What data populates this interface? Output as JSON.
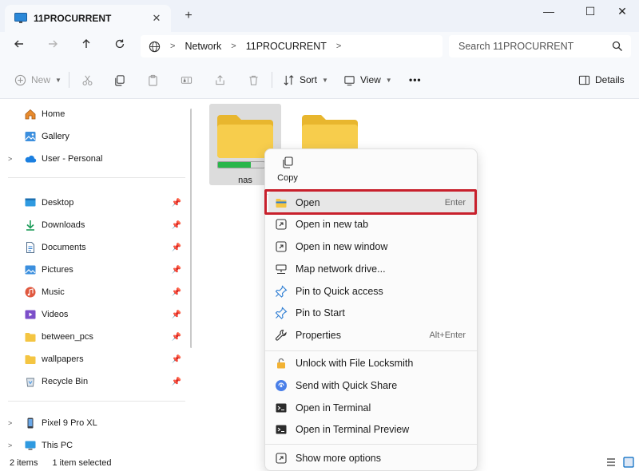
{
  "window": {
    "tab_title": "11PROCURRENT",
    "tab_close": "✕",
    "new_tab": "+",
    "minimize": "—",
    "maximize": "☐",
    "close": "✕"
  },
  "address": {
    "crumbs": [
      "Network",
      "11PROCURRENT"
    ],
    "search_placeholder": "Search 11PROCURRENT"
  },
  "toolbar": {
    "new_label": "New",
    "sort_label": "Sort",
    "view_label": "View",
    "more_label": "•••",
    "details_label": "Details"
  },
  "sidebar": {
    "items": [
      {
        "label": "Home",
        "icon": "home-icon"
      },
      {
        "label": "Gallery",
        "icon": "gallery-icon"
      },
      {
        "label": "User - Personal",
        "icon": "onedrive-icon"
      },
      {
        "label": "Desktop",
        "icon": "desktop-icon"
      },
      {
        "label": "Downloads",
        "icon": "downloads-icon"
      },
      {
        "label": "Documents",
        "icon": "documents-icon"
      },
      {
        "label": "Pictures",
        "icon": "pictures-icon"
      },
      {
        "label": "Music",
        "icon": "music-icon"
      },
      {
        "label": "Videos",
        "icon": "videos-icon"
      },
      {
        "label": "between_pcs",
        "icon": "folder-icon"
      },
      {
        "label": "wallpapers",
        "icon": "folder-icon"
      },
      {
        "label": "Recycle Bin",
        "icon": "recycle-bin-icon"
      },
      {
        "label": "Pixel 9 Pro XL",
        "icon": "phone-icon"
      },
      {
        "label": "This PC",
        "icon": "computer-icon"
      }
    ]
  },
  "content": {
    "folders": [
      {
        "name": "nas",
        "selected": true,
        "drive_usage_fraction": 0.7
      },
      {
        "name": "",
        "selected": false
      }
    ]
  },
  "context_menu": {
    "quick_actions": [
      {
        "label": "Copy",
        "icon": "copy-icon"
      }
    ],
    "items": [
      {
        "label": "Open",
        "shortcut": "Enter",
        "icon": "folder-open-icon"
      },
      {
        "label": "Open in new tab",
        "shortcut": "",
        "icon": "new-tab-icon"
      },
      {
        "label": "Open in new window",
        "shortcut": "",
        "icon": "new-window-icon"
      },
      {
        "label": "Map network drive...",
        "shortcut": "",
        "icon": "network-drive-icon"
      },
      {
        "label": "Pin to Quick access",
        "shortcut": "",
        "icon": "pin-icon"
      },
      {
        "label": "Pin to Start",
        "shortcut": "",
        "icon": "pin-icon"
      },
      {
        "label": "Properties",
        "shortcut": "Alt+Enter",
        "icon": "wrench-icon"
      },
      {
        "label": "Unlock with File Locksmith",
        "shortcut": "",
        "icon": "lock-icon"
      },
      {
        "label": "Send with Quick Share",
        "shortcut": "",
        "icon": "quick-share-icon"
      },
      {
        "label": "Open in Terminal",
        "shortcut": "",
        "icon": "terminal-icon"
      },
      {
        "label": "Open in Terminal Preview",
        "shortcut": "",
        "icon": "terminal-icon"
      },
      {
        "label": "Show more options",
        "shortcut": "",
        "icon": "more-options-icon"
      }
    ]
  },
  "status": {
    "item_count": "2 items",
    "selection": "1 item selected"
  },
  "colors": {
    "accent": "#0067c0",
    "highlight_border": "#c8202c",
    "folder": "#f4c542",
    "drive_fill": "#29b64a"
  }
}
